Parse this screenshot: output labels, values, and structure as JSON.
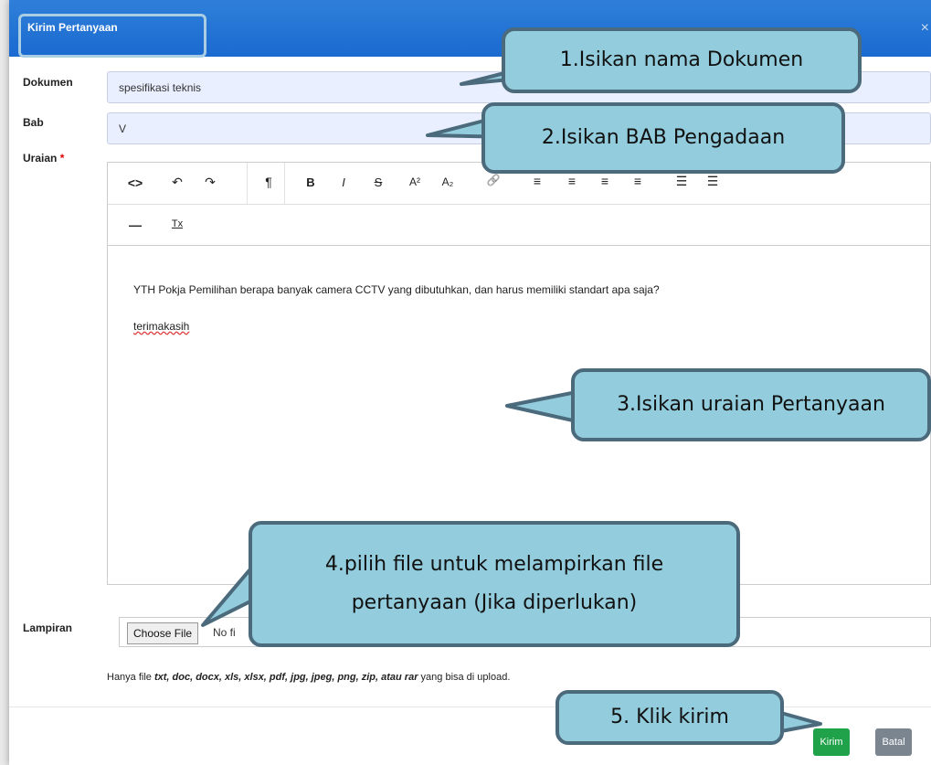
{
  "modal": {
    "title": "Kirim Pertanyaan",
    "close": "×"
  },
  "form": {
    "dokumen_label": "Dokumen",
    "dokumen_value": "spesifikasi teknis",
    "bab_label": "Bab",
    "bab_value": "V",
    "uraian_label": "Uraian",
    "required_mark": "*",
    "lampiran_label": "Lampiran",
    "choose_file": "Choose File",
    "no_file": "No fi",
    "hint_prefix": "Hanya file ",
    "hint_types": "txt, doc, docx, xls, xlsx, pdf, jpg, jpeg, png, zip, atau rar",
    "hint_suffix": " yang bisa di upload."
  },
  "toolbar": {
    "row1": [
      "<>",
      "↶",
      "↷",
      "¶",
      "B",
      "I",
      "S",
      "A²",
      "A₂",
      "🔗",
      "≡",
      "≡",
      "≡",
      "≡",
      "☰",
      "☰"
    ],
    "row2": [
      "—",
      "Tx"
    ]
  },
  "editor_content": {
    "line1": "YTH Pokja Pemilihan berapa banyak camera CCTV yang dibutuhkan, dan harus memiliki standart apa saja?",
    "line2": "terimakasih"
  },
  "buttons": {
    "kirim": "Kirim",
    "batal": "Batal"
  },
  "callouts": {
    "c1": "1.Isikan nama Dokumen",
    "c2": "2.Isikan BAB Pengadaan",
    "c3": "3.Isikan uraian Pertanyaan",
    "c4_line1": "4.pilih file untuk melampirkan file",
    "c4_line2": "pertanyaan (Jika diperlukan)",
    "c5": "5. Klik kirim"
  },
  "colors": {
    "header": "#1a6ad1",
    "callout_fill": "#93cddd",
    "callout_border": "#4b6a7c",
    "kirim": "#1fa24a",
    "batal": "#7a8590"
  }
}
